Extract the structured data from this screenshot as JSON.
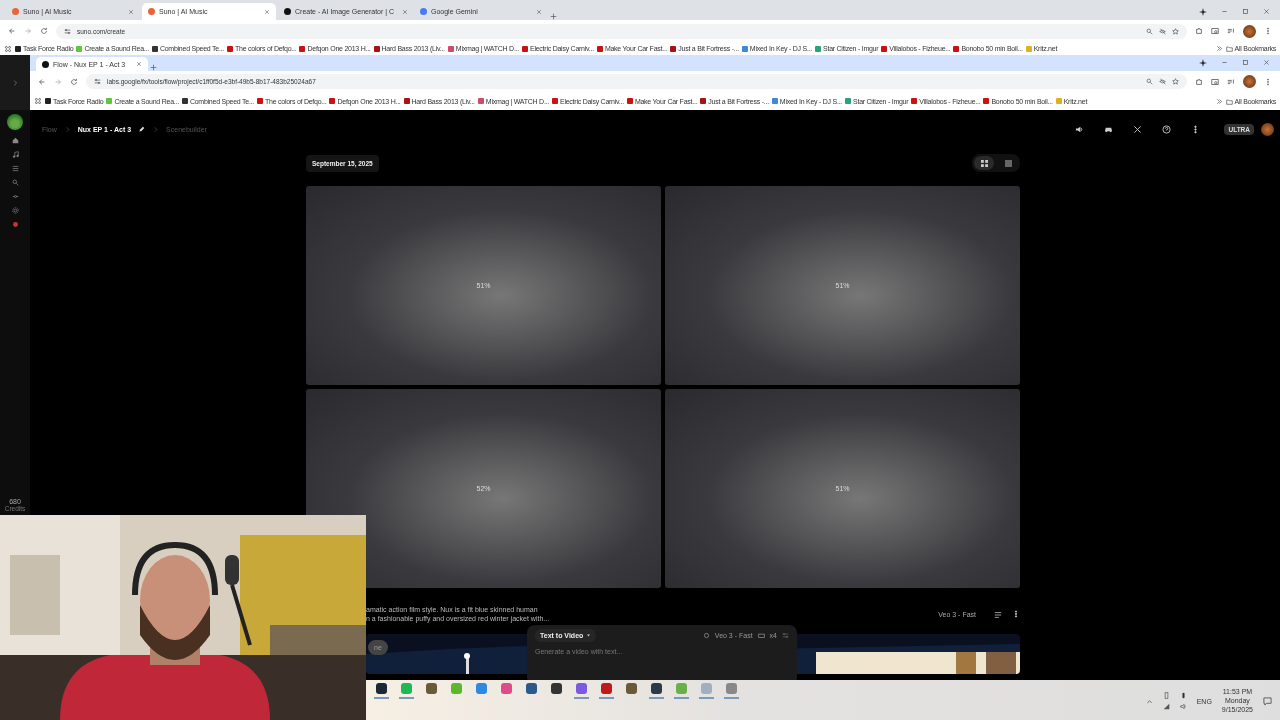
{
  "outer_browser": {
    "tabs": [
      {
        "title": "Suno | AI Music",
        "selected": false,
        "color": "#e8643c"
      },
      {
        "title": "Suno | AI Music",
        "selected": true,
        "color": "#e8643c"
      },
      {
        "title": "Create - AI Image Generator | C",
        "selected": false,
        "color": "#111111"
      },
      {
        "title": "Google Gemini",
        "selected": false,
        "color": "#4a7bf0"
      }
    ],
    "address": "suno.com/create",
    "bookmarks": [
      {
        "title": "Task Force Radio",
        "color": "#222222"
      },
      {
        "title": "Create a Sound Rea...",
        "color": "#5ac83a"
      },
      {
        "title": "Combined Speed Te...",
        "color": "#333333"
      },
      {
        "title": "The colors of Defqo...",
        "color": "#cc1111"
      },
      {
        "title": "Defqon One 2013 H...",
        "color": "#cc1111"
      },
      {
        "title": "Hard Bass 2013 (Liv...",
        "color": "#aa1111"
      },
      {
        "title": "Mixmag | WATCH D...",
        "color": "#d04a6a"
      },
      {
        "title": "Electric Daisy Carniv...",
        "color": "#cc1111"
      },
      {
        "title": "Make Your Car Fast...",
        "color": "#cc1111"
      },
      {
        "title": "Just a Bit Fortress -...",
        "color": "#aa1111"
      },
      {
        "title": "Mixed In Key - DJ S...",
        "color": "#3a8ad8"
      },
      {
        "title": "Star Citizen - Imgur",
        "color": "#2aa37a"
      },
      {
        "title": "Villalobos - Fizheue...",
        "color": "#cc1111"
      },
      {
        "title": "Bonobo 50 min Boil...",
        "color": "#cc1111"
      },
      {
        "title": "Kritz.net",
        "color": "#e0b020"
      }
    ],
    "all_bookmarks": "All Bookmarks"
  },
  "inner_browser": {
    "tabs": [
      {
        "title": "Flow - Nux EP 1 - Act 3",
        "selected": true,
        "color": "#111111"
      }
    ],
    "address": "labs.google/fx/tools/flow/project/c1ff0f5d-e3bf-49b5-8b17-483b25024a67",
    "bookmarks": [
      {
        "title": "Task Force Radio",
        "color": "#222222"
      },
      {
        "title": "Create a Sound Rea...",
        "color": "#5ac83a"
      },
      {
        "title": "Combined Speed Te...",
        "color": "#333333"
      },
      {
        "title": "The colors of Defqo...",
        "color": "#cc1111"
      },
      {
        "title": "Defqon One 2013 H...",
        "color": "#cc1111"
      },
      {
        "title": "Hard Bass 2013 (Liv...",
        "color": "#aa1111"
      },
      {
        "title": "Mixmag | WATCH D...",
        "color": "#d04a6a"
      },
      {
        "title": "Electric Daisy Carniv...",
        "color": "#cc1111"
      },
      {
        "title": "Make Your Car Fast...",
        "color": "#cc1111"
      },
      {
        "title": "Just a Bit Fortress -...",
        "color": "#aa1111"
      },
      {
        "title": "Mixed In Key - DJ S...",
        "color": "#3a8ad8"
      },
      {
        "title": "Star Citizen - Imgur",
        "color": "#2aa37a"
      },
      {
        "title": "Villalobos - Fizheue...",
        "color": "#cc1111"
      },
      {
        "title": "Bonobo 50 min Boil...",
        "color": "#cc1111"
      },
      {
        "title": "Kritz.net",
        "color": "#e0b020"
      }
    ],
    "all_bookmarks": "All Bookmarks"
  },
  "flow": {
    "credits": "680",
    "credits_label": "Credits",
    "breadcrumb": [
      {
        "label": "Flow",
        "current": false
      },
      {
        "label": "Nux EP 1 - Act 3",
        "current": true
      },
      {
        "label": "Scenebuilder",
        "current": false
      }
    ],
    "plan_badge": "ULTRA",
    "date": "September 15, 2025",
    "view_modes": [
      {
        "kind": "grid",
        "selected": true
      },
      {
        "kind": "list",
        "selected": false
      }
    ],
    "tiles": [
      {
        "progress": "51%"
      },
      {
        "progress": "51%"
      },
      {
        "progress": "52%"
      },
      {
        "progress": "51%"
      }
    ],
    "prompt_lines": [
      "amatic action film style. Nux is a fit blue skinned human",
      "n a fashionable puffy and oversized red winter jacket with..."
    ],
    "model": "Veo 3 - Fast",
    "partial_button": "ne",
    "composer": {
      "mode": "Text to Video",
      "model": "Veo 3 - Fast",
      "count": "x4",
      "placeholder": "Generate a video with text..."
    }
  },
  "taskbar": {
    "apps": [
      {
        "color": "#1b2838",
        "running": true
      },
      {
        "color": "#1db954",
        "running": true
      },
      {
        "color": "#6b5a3a",
        "running": false
      },
      {
        "color": "#5cb82a",
        "running": false
      },
      {
        "color": "#2d8ae0",
        "running": false
      },
      {
        "color": "#e04a8a",
        "running": false
      },
      {
        "color": "#2a5a8a",
        "running": false
      },
      {
        "color": "#333333",
        "running": false
      },
      {
        "color": "#7a5ae0",
        "running": true
      },
      {
        "color": "#c01a1a",
        "running": true
      },
      {
        "color": "#6b5a3a",
        "running": false
      },
      {
        "color": "#2a3a4a",
        "running": true
      },
      {
        "color": "#6ab04a",
        "running": true
      },
      {
        "color": "#a0b0c0",
        "running": true
      },
      {
        "color": "#888888",
        "running": true
      }
    ],
    "language": "ENG",
    "time": "11:53 PM",
    "day": "Monday",
    "date": "9/15/2025"
  }
}
